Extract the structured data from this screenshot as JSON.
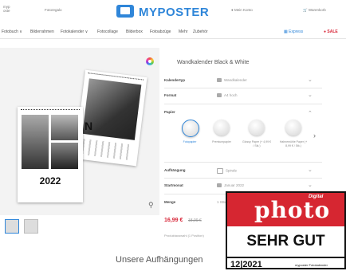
{
  "header": {
    "brand": "MYPOSTER",
    "left_text": "Fotoregalo",
    "account": "Mein Konto",
    "cart": "Warenkorb"
  },
  "nav": {
    "items": [
      "Fotobuch ∨",
      "Bilderrahmen",
      "Fotokalender ∨",
      "Fotocollage",
      "Bilderbox",
      "Fotoabzüge",
      "Mehr",
      "Zubehör"
    ],
    "express": "Express",
    "sale": "SALE"
  },
  "product": {
    "title": "Wandkalender Black & White",
    "calendar_year": "2022",
    "calendar_letter": "N"
  },
  "options": [
    {
      "label": "Kalendertyp",
      "value": "Wandkalender"
    },
    {
      "label": "Format",
      "value": "A4 hoch"
    },
    {
      "label": "Papier",
      "value": ""
    },
    {
      "label": "Aufhängung",
      "value": "Spirale"
    },
    {
      "label": "Startmonat",
      "value": "Januar 2022"
    },
    {
      "label": "Menge",
      "value": "1 Stück"
    }
  ],
  "papers": [
    {
      "label": "Fotopapier"
    },
    {
      "label": "Premiumpapier"
    },
    {
      "label": "Glossy Paper (+ 4,99 € / Stk.)"
    },
    {
      "label": "Hahnemühle Paper (+ 8,99 € / Stk.)"
    }
  ],
  "price": {
    "current": "16,99 €",
    "old": "18,99 €",
    "note": "Produktauswahl (1 Position)"
  },
  "section_heading": "Unsere Aufhängungen",
  "badge": {
    "digital": "Digital",
    "magazine": "photo",
    "rating": "SEHR GUT",
    "date": "12|2021",
    "subject": "myposter Fotokalender"
  },
  "colors": {
    "brand_blue": "#2f86d9",
    "sale_red": "#d8283a",
    "badge_red": "#d62631"
  }
}
